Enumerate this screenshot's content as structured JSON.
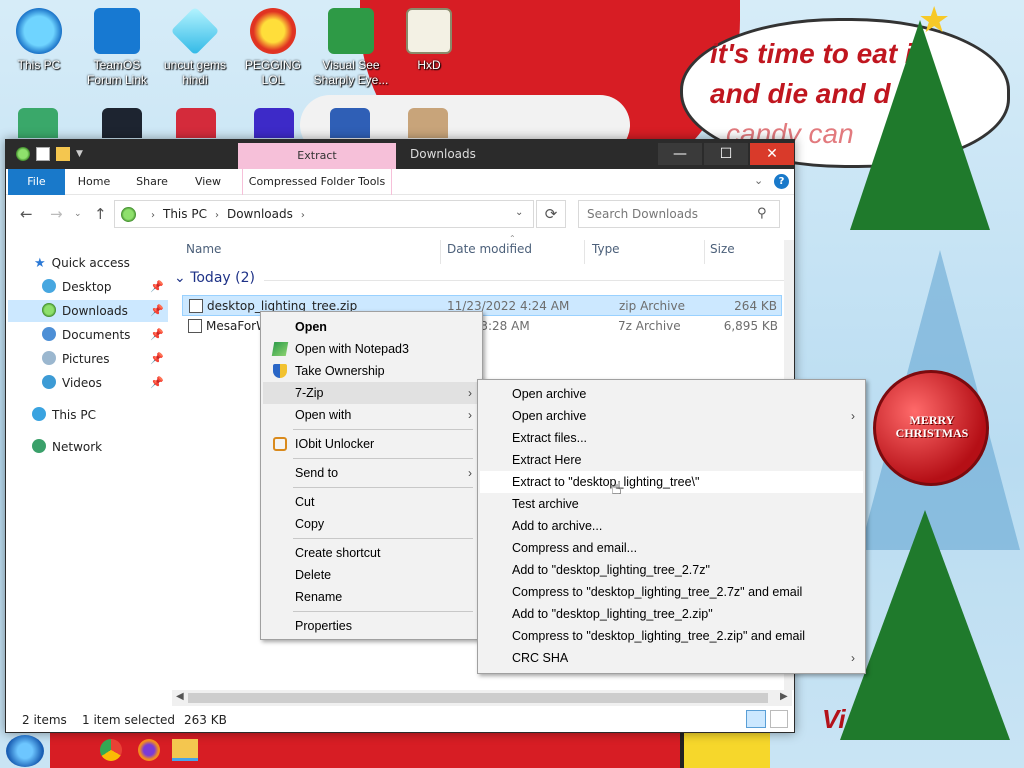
{
  "desktop": {
    "icons": [
      {
        "label": "This PC",
        "icon": "this-pc-icon"
      },
      {
        "label": "TeamOS Forum Link",
        "icon": "gear-icon"
      },
      {
        "label": "uncut gems hindi",
        "icon": "gem-icon"
      },
      {
        "label": "PEGGING LOL",
        "icon": "pegging-app-icon"
      },
      {
        "label": "Visual See Sharply Eye...",
        "icon": "csharp-icon"
      },
      {
        "label": "HxD",
        "icon": "hxd-icon"
      }
    ],
    "wallpaper": {
      "bubble_line1": "it's time to eat it",
      "bubble_line2": "and die and d",
      "bubble_line3": "candy can",
      "ornament_text": "MERRY CHRISTMAS",
      "bottom_text": "Vi"
    }
  },
  "window": {
    "title": "Downloads",
    "context_tab": "Extract",
    "ribbon_tabs": {
      "file": "File",
      "home": "Home",
      "share": "Share",
      "view": "View",
      "compressed": "Compressed Folder Tools"
    },
    "address": {
      "crumbs": [
        "This PC",
        "Downloads"
      ]
    },
    "search": {
      "placeholder": "Search Downloads"
    },
    "sidebar": {
      "quick_access": "Quick access",
      "items": [
        "Desktop",
        "Downloads",
        "Documents",
        "Pictures",
        "Videos"
      ],
      "this_pc": "This PC",
      "network": "Network"
    },
    "columns": {
      "name": "Name",
      "date": "Date modified",
      "type": "Type",
      "size": "Size"
    },
    "group_label": "Today (2)",
    "files": [
      {
        "name": "desktop_lighting_tree.zip",
        "date": "11/23/2022 4:24 AM",
        "type": "zip Archive",
        "size": "264 KB"
      },
      {
        "name": "MesaForW",
        "date": "2022 3:28 AM",
        "type": "7z Archive",
        "size": "6,895 KB"
      }
    ],
    "status": {
      "items": "2 items",
      "selected": "1 item selected",
      "size": "263 KB"
    }
  },
  "context_menu": {
    "items": {
      "open": "Open",
      "notepad": "Open with Notepad3",
      "ownership": "Take Ownership",
      "sevenzip": "7-Zip",
      "openwith": "Open with",
      "iobit": "IObit Unlocker",
      "sendto": "Send to",
      "cut": "Cut",
      "copy": "Copy",
      "shortcut": "Create shortcut",
      "delete": "Delete",
      "rename": "Rename",
      "properties": "Properties"
    }
  },
  "submenu": {
    "items": [
      "Open archive",
      "Open archive",
      "Extract files...",
      "Extract Here",
      "Extract to \"desktop_lighting_tree\\\"",
      "Test archive",
      "Add to archive...",
      "Compress and email...",
      "Add to \"desktop_lighting_tree_2.7z\"",
      "Compress to \"desktop_lighting_tree_2.7z\" and email",
      "Add to \"desktop_lighting_tree_2.zip\"",
      "Compress to \"desktop_lighting_tree_2.zip\" and email",
      "CRC SHA"
    ]
  },
  "colors": {
    "accent": "#1979ca",
    "selection": "#cce8ff",
    "extract_tab": "#f6c0d9",
    "close": "#d93a2a"
  }
}
